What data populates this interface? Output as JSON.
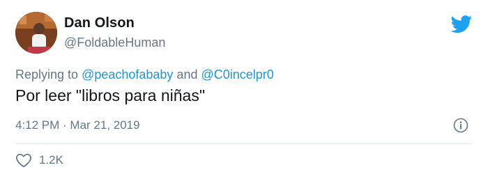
{
  "author": {
    "name": "Dan Olson",
    "handle": "@FoldableHuman"
  },
  "reply": {
    "prefix": "Replying to ",
    "mention1": "@peachofababy",
    "joiner": " and ",
    "mention2": "@C0incelpr0"
  },
  "tweet": {
    "text": "Por leer \"libros para niñas\"",
    "time": "4:12 PM",
    "separator": " · ",
    "date": "Mar 21, 2019"
  },
  "actions": {
    "like_count": "1.2K"
  },
  "icons": {
    "brand": "twitter-bird-icon",
    "info": "info-icon",
    "like": "heart-icon"
  },
  "colors": {
    "brand": "#1da1f2",
    "mention": "#1b95e0",
    "secondary_text": "#657786",
    "primary_text": "#14171a"
  }
}
